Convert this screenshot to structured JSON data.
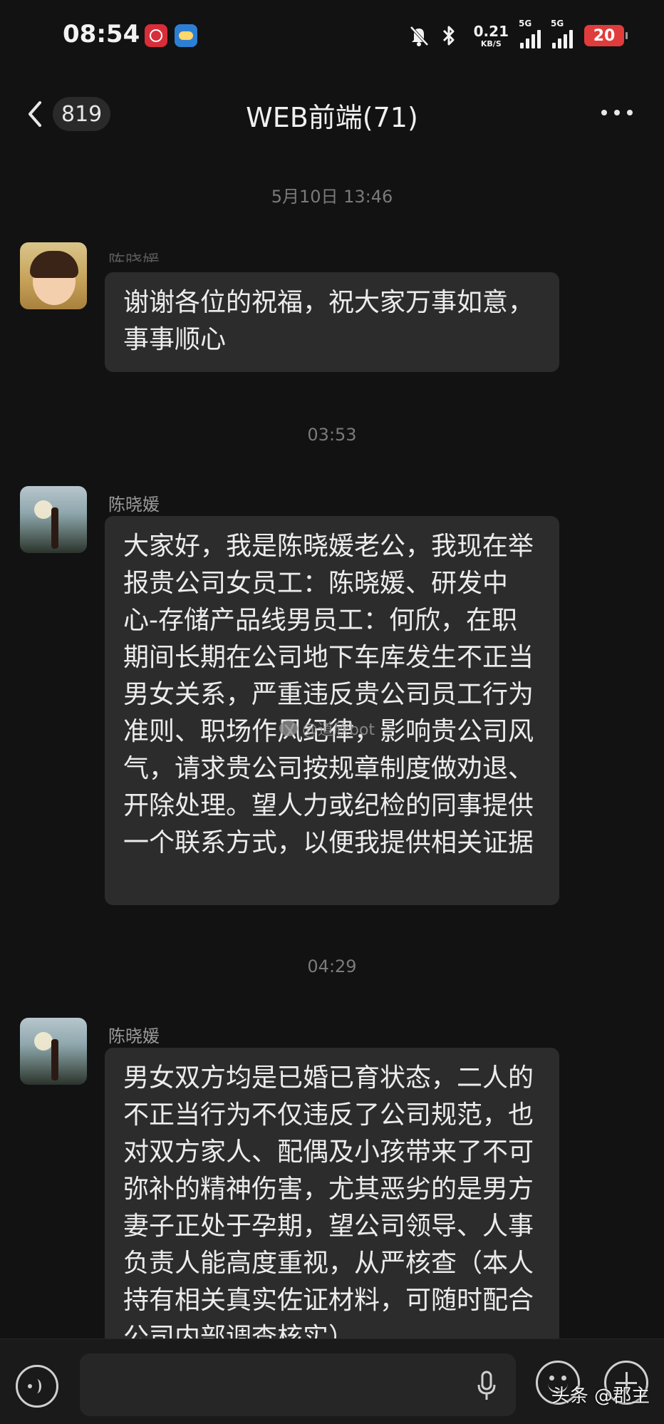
{
  "status_bar": {
    "time": "08:54",
    "network_speed": "0.21",
    "network_speed_unit": "KB/S",
    "network_type_1": "5G",
    "network_type_2": "5G",
    "battery": "20",
    "colors": {
      "battery": "#e03c3c"
    }
  },
  "header": {
    "back_count": "819",
    "title": "WEB前端(71)"
  },
  "chat": {
    "messages": [
      {
        "timestamp": "5月10日 13:46",
        "sender": "陈晓媛",
        "text": "谢谢各位的祝福，祝大家万事如意，事事顺心"
      },
      {
        "timestamp": "03:53",
        "sender": "陈晓媛",
        "text": "大家好，我是陈晓媛老公，我现在举报贵公司女员工：陈晓媛、研发中心-存储产品线男员工：何欣，在职期间长期在公司地下车库发生不正当男女关系，严重违反贵公司员工行为准则、职场作风纪律，影响贵公司风气，请求贵公司按规章制度做劝退、开除处理。望人力或纪检的同事提供一个联系方式，以便我提供相关证据"
      },
      {
        "timestamp": "04:29",
        "sender": "陈晓媛",
        "text": "男女双方均是已婚已育状态，二人的不正当行为不仅违反了公司规范，也对双方家人、配偶及小孩带来了不可弥补的精神伤害，尤其恶劣的是男方妻子正处于孕期，望公司领导、人事负责人能高度重视，从严核查（本人持有相关真实佐证材料，可随时配合公司内部调查核实）"
      }
    ]
  },
  "overlay": {
    "weibo_watermark": "@道欣bot",
    "source_watermark": "头条 @郡主"
  },
  "input_bar": {
    "placeholder": "",
    "icons": [
      "voice-icon",
      "mic-icon",
      "emoji-icon",
      "plus-icon"
    ]
  },
  "theme": {
    "background": "#121212",
    "bubble": "#2c2c2c",
    "text": "#ececec",
    "muted_text": "#7a7a7a"
  }
}
